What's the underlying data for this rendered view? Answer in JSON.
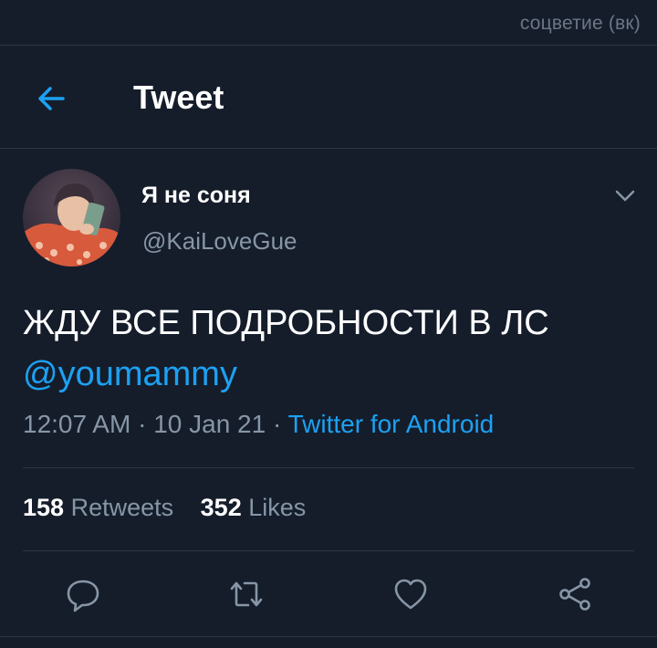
{
  "watermark": "соцветие (вк)",
  "header": {
    "title": "Tweet",
    "back_icon": "arrow-left-icon"
  },
  "author": {
    "display_name": "Я не соня",
    "handle": "@KaiLoveGue",
    "menu_icon": "chevron-down-icon"
  },
  "tweet": {
    "text": "ЖДУ ВСЕ ПОДРОБНОСТИ В ЛС",
    "mention": "@youmammy",
    "time": "12:07 AM",
    "date": "10 Jan 21",
    "separator": "·",
    "source": "Twitter for Android"
  },
  "stats": {
    "retweets_count": "158",
    "retweets_label": "Retweets",
    "likes_count": "352",
    "likes_label": "Likes"
  },
  "actions": [
    {
      "icon": "reply-icon"
    },
    {
      "icon": "retweet-icon"
    },
    {
      "icon": "like-icon"
    },
    {
      "icon": "share-icon"
    }
  ],
  "colors": {
    "background": "#151d2b",
    "accent": "#1da1f2",
    "muted_text": "#8796a6",
    "divider": "#2b3645"
  }
}
